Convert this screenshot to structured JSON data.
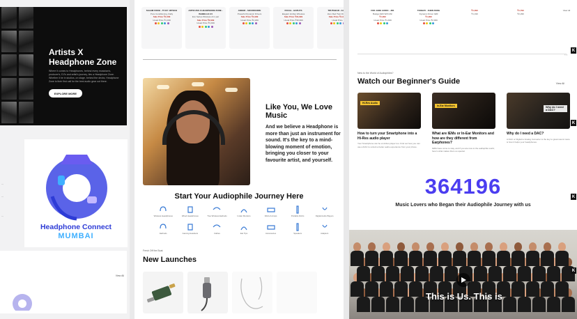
{
  "col1": {
    "artist": {
      "title": "Artists X Headphone Zone",
      "desc": "Where it comes to Headphones, behind every musician's, producer's, DJ's and artist's journey, lies a Headphone Zone. Whether it be in studios, on stage, behind the decks, Headphone Zone is their first call for the best audio gear out there.",
      "cta": "EXPLORE MORE"
    },
    "connect": {
      "title": "Headphone Connect",
      "city": "MUMBAI"
    },
    "side_bits": [
      "...",
      "...",
      "..."
    ],
    "more": "View All"
  },
  "col2": {
    "products": [
      {
        "name": "SALEM FOSSI - TF BY 1DTECH",
        "line": "Pure Conditioning, Daily",
        "price": "Sale Price ₹1,099",
        "was": "Usual Price ₹1,199"
      },
      {
        "name": "ARTICUSS X HEADPHONE ZONE - ISABELLE 2.0",
        "line": "Eco Series Wireless & In-ear",
        "price": "Sale Price ₹2,999",
        "was": "Usual Price ₹3,499"
      },
      {
        "name": "ANKER - SOUNDCORE",
        "line": "Powerful Dynamic Drivers",
        "price": "Sale Price ₹1,999",
        "was": "Usual Price ₹2,299"
      },
      {
        "name": "FOCAL - BATHYS",
        "line": "Elegant Hi-Res Wireless",
        "price": "Sale Price ₹34,999",
        "was": "Usual Price ₹39,999"
      },
      {
        "name": "TRUTHEAR - GATE",
        "line": "Zero Red Twin Driver",
        "price": "Sale Price ₹1,999",
        "was": "Usual Price"
      }
    ],
    "like": {
      "title": "Like You, We Love Music",
      "body": "And we believe a Headphone is more than just an instrument for sound. It's the key to a mind-blowing moment of emotion, bringing you closer to your favourite artist, and yourself."
    },
    "journey": {
      "title": "Start Your Audiophile Journey Here",
      "items": [
        "Wireless Headphones",
        "Wired Headphones",
        "True Wireless Earbuds",
        "In-Ear Monitors",
        "DACs & Amps",
        "Portable DACs",
        "Digital Audio Players",
        "Earbuds",
        "Gaming Headsets",
        "Cables",
        "Ear Tips",
        "Accessories",
        "Speakers",
        "Adapters"
      ]
    },
    "launches": {
      "small": "Fresh Off the Boat",
      "title": "New Launches"
    }
  },
  "col3": {
    "products": [
      {
        "name": "FIIO JADE AUDIO - JD1",
        "line": "Budget IEM With Mic",
        "price": "₹1,999",
        "was": "Usual Price ₹1,499"
      },
      {
        "name": "TANGZU - ZHEN FENG",
        "line": "Dynamic Driver IEM",
        "price": "₹1,999",
        "was": "Usual Price ₹2,999"
      },
      {
        "name": "",
        "line": "",
        "price": "₹1,099",
        "was": "₹1,199"
      },
      {
        "name": "",
        "line": "",
        "price": "₹1,799",
        "was": "₹2,299"
      },
      {
        "name": "",
        "line": "",
        "price": "",
        "was": "View All"
      }
    ],
    "guide": {
      "small": "New to the World of Audiophiles?",
      "title": "Watch our Beginner's Guide",
      "view_all": "View All",
      "videos": [
        {
          "tag": "Hi-Res Audio",
          "title": "How to turn your Smartphone into a Hi-Res audio player",
          "desc": "Your Smartphone can be a Hi-Res player too. Find out how you can use a DAC to unlock a better audio experience from your phone."
        },
        {
          "tag": "In-Ear Monitors",
          "title": "What are IEMs or In-Ear Monitors and how are they different from Earphones?",
          "desc": "IEMs have come to stay, and if you are new to the audiophile world, here's what makes them so special."
        },
        {
          "tag": "Why do I need a DAC?",
          "title": "Why do I need a DAC?",
          "desc": "A DAC or Digital to Analog Converter is the key to great sound. Here is how it helps your headphones."
        }
      ]
    },
    "counter": "364196",
    "counter_label": "Music Lovers who Began their Audiophile Journey with us",
    "group_caption": "This is Us. This is"
  }
}
